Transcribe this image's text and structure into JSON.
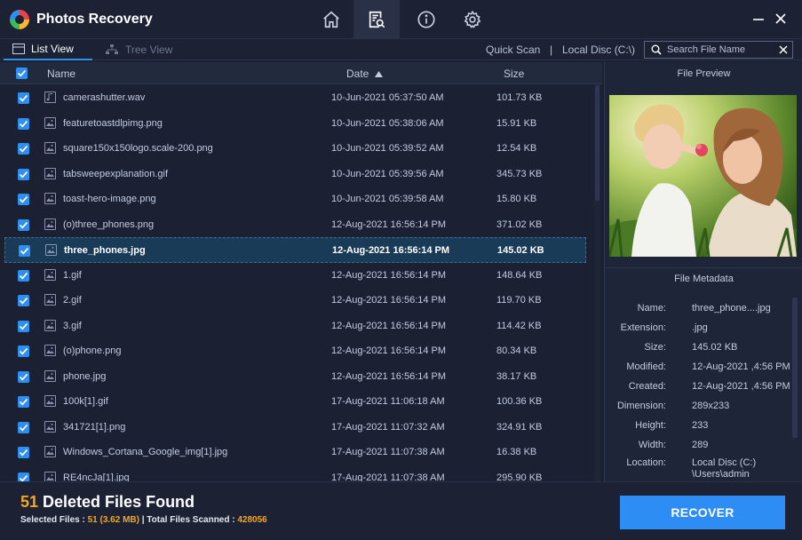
{
  "app": {
    "title": "Photos Recovery"
  },
  "nav": {
    "tabs": [
      {
        "icon": "home-icon",
        "active": false
      },
      {
        "icon": "scan-report-icon",
        "active": true
      },
      {
        "icon": "info-icon",
        "active": false
      },
      {
        "icon": "settings-gear-icon",
        "active": false
      }
    ]
  },
  "toolbar": {
    "list_view": "List View",
    "tree_view": "Tree View",
    "scan_type": "Quick Scan",
    "separator": "|",
    "location": "Local Disc (C:\\)",
    "search_placeholder": "Search File Name"
  },
  "table": {
    "columns": {
      "name": "Name",
      "date": "Date",
      "size": "Size"
    },
    "rows": [
      {
        "name": "camerashutter.wav",
        "date": "10-Jun-2021 05:37:50 AM",
        "size": "101.73 KB",
        "type": "audio",
        "checked": true,
        "selected": false
      },
      {
        "name": "featuretoastdlpimg.png",
        "date": "10-Jun-2021 05:38:06 AM",
        "size": "15.91 KB",
        "type": "image",
        "checked": true,
        "selected": false
      },
      {
        "name": "square150x150logo.scale-200.png",
        "date": "10-Jun-2021 05:39:52 AM",
        "size": "12.54 KB",
        "type": "image",
        "checked": true,
        "selected": false
      },
      {
        "name": "tabsweepexplanation.gif",
        "date": "10-Jun-2021 05:39:56 AM",
        "size": "345.73 KB",
        "type": "image",
        "checked": true,
        "selected": false
      },
      {
        "name": "toast-hero-image.png",
        "date": "10-Jun-2021 05:39:58 AM",
        "size": "15.80 KB",
        "type": "image",
        "checked": true,
        "selected": false
      },
      {
        "name": "(o)three_phones.png",
        "date": "12-Aug-2021 16:56:14 PM",
        "size": "371.02 KB",
        "type": "image",
        "checked": true,
        "selected": false
      },
      {
        "name": "three_phones.jpg",
        "date": "12-Aug-2021 16:56:14 PM",
        "size": "145.02 KB",
        "type": "image",
        "checked": true,
        "selected": true
      },
      {
        "name": "1.gif",
        "date": "12-Aug-2021 16:56:14 PM",
        "size": "148.64 KB",
        "type": "image",
        "checked": true,
        "selected": false
      },
      {
        "name": "2.gif",
        "date": "12-Aug-2021 16:56:14 PM",
        "size": "119.70 KB",
        "type": "image",
        "checked": true,
        "selected": false
      },
      {
        "name": "3.gif",
        "date": "12-Aug-2021 16:56:14 PM",
        "size": "114.42 KB",
        "type": "image",
        "checked": true,
        "selected": false
      },
      {
        "name": "(o)phone.png",
        "date": "12-Aug-2021 16:56:14 PM",
        "size": "80.34 KB",
        "type": "image",
        "checked": true,
        "selected": false
      },
      {
        "name": "phone.jpg",
        "date": "12-Aug-2021 16:56:14 PM",
        "size": "38.17 KB",
        "type": "image",
        "checked": true,
        "selected": false
      },
      {
        "name": "100k[1].gif",
        "date": "17-Aug-2021 11:06:18 AM",
        "size": "100.36 KB",
        "type": "image",
        "checked": true,
        "selected": false
      },
      {
        "name": "341721[1].png",
        "date": "17-Aug-2021 11:07:32 AM",
        "size": "324.91 KB",
        "type": "image",
        "checked": true,
        "selected": false
      },
      {
        "name": "Windows_Cortana_Google_img[1].jpg",
        "date": "17-Aug-2021 11:07:38 AM",
        "size": "16.38 KB",
        "type": "image",
        "checked": true,
        "selected": false
      },
      {
        "name": "RE4ncJa[1].jpg",
        "date": "17-Aug-2021 11:07:38 AM",
        "size": "295.90 KB",
        "type": "image",
        "checked": true,
        "selected": false
      }
    ]
  },
  "preview": {
    "title": "File Preview",
    "metadata_title": "File Metadata",
    "metadata": [
      {
        "label": "Name:",
        "value": "three_phone....jpg"
      },
      {
        "label": "Extension:",
        "value": ".jpg"
      },
      {
        "label": "Size:",
        "value": "145.02 KB"
      },
      {
        "label": "Modified:",
        "value": "12-Aug-2021 ,4:56 PM"
      },
      {
        "label": "Created:",
        "value": "12-Aug-2021 ,4:56 PM"
      },
      {
        "label": "Dimension:",
        "value": "289x233"
      },
      {
        "label": "Height:",
        "value": "233"
      },
      {
        "label": "Width:",
        "value": "289"
      },
      {
        "label": "Location:",
        "value": "Local Disc (C:)"
      },
      {
        "label": "",
        "value": "\\Users\\admin"
      }
    ]
  },
  "footer": {
    "found_count": "51",
    "found_label": " Deleted Files Found",
    "selected_label": "Selected Files : ",
    "selected_value": "51 (3.62 MB)",
    "scanned_label": " | Total Files Scanned : ",
    "scanned_value": "428056",
    "recover_label": "RECOVER"
  },
  "colors": {
    "accent": "#2f8ff0",
    "highlight": "#f5a623",
    "background": "#1b2133"
  }
}
